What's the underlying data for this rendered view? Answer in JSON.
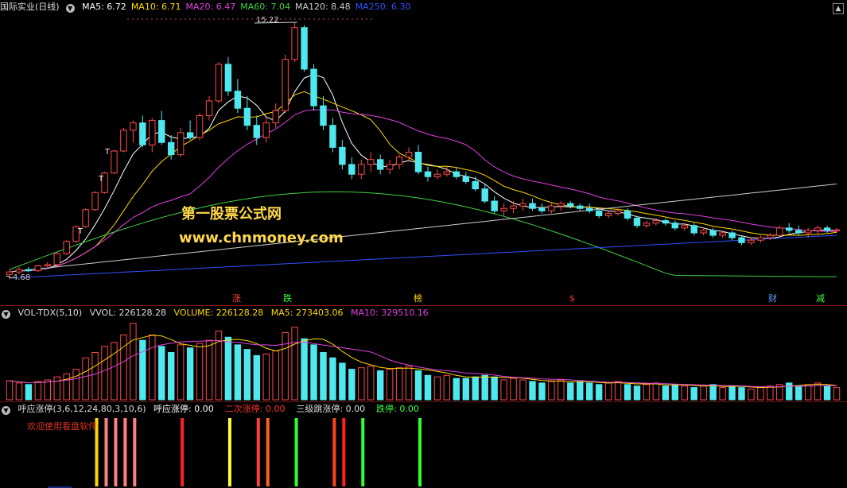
{
  "main": {
    "title": "国际实业(日线)",
    "ma": [
      {
        "label": "MA5: 6.72",
        "color": "#ffffff"
      },
      {
        "label": "MA10: 6.71",
        "color": "#ffd700"
      },
      {
        "label": "MA20: 6.47",
        "color": "#e040e0"
      },
      {
        "label": "MA60: 7.04",
        "color": "#40d040"
      },
      {
        "label": "MA120: 8.48",
        "color": "#cccccc"
      },
      {
        "label": "MA250: 6.30",
        "color": "#3050ff"
      }
    ],
    "high_label": "15.22",
    "low_label": "4.68",
    "t_marks": [
      "T",
      "T",
      "T"
    ],
    "watermark1": "第一股票公式网",
    "watermark2": "www.chnmoney.com",
    "events": [
      {
        "text": "涨",
        "color": "#ff4040"
      },
      {
        "text": "跌",
        "color": "#40ff40"
      },
      {
        "text": "榜",
        "color": "#ffd700"
      },
      {
        "text": "$",
        "color": "#ff3030"
      },
      {
        "text": "财",
        "color": "#60a0ff"
      },
      {
        "text": "减",
        "color": "#40ff40"
      }
    ]
  },
  "volume": {
    "name": "VOL-TDX(5,10)",
    "vvol": "VVOL: 226128.28",
    "volume": "VOLUME: 226128.28",
    "ma5": "MA5: 273403.06",
    "ma10": "MA10: 329510.16"
  },
  "indicator": {
    "name": "呼应涨停(3,6,12,24,80,3,10,6)",
    "items": [
      {
        "label": "呼应涨停: 0.00",
        "color": "#ffffff"
      },
      {
        "label": "二次涨停: 0.00",
        "color": "#ff3030"
      },
      {
        "label": "三级跳涨停: 0.00",
        "color": "#dddddd"
      },
      {
        "label": "跌停: 0.00",
        "color": "#40ff40"
      }
    ],
    "welcome": "欢迎使用看盘软件"
  },
  "chart_data": {
    "type": "candlestick",
    "price_range": [
      4.68,
      15.22
    ],
    "candles": [
      [
        4.9,
        5.1,
        4.7,
        5.0
      ],
      [
        5.0,
        5.2,
        4.9,
        5.1
      ],
      [
        5.1,
        5.2,
        5.0,
        5.05
      ],
      [
        5.05,
        5.3,
        5.0,
        5.25
      ],
      [
        5.25,
        5.4,
        5.2,
        5.3
      ],
      [
        5.3,
        5.8,
        5.3,
        5.75
      ],
      [
        5.75,
        6.3,
        5.7,
        6.25
      ],
      [
        6.25,
        6.9,
        6.2,
        6.85
      ],
      [
        6.85,
        7.6,
        6.8,
        7.55
      ],
      [
        7.55,
        8.3,
        7.5,
        8.25
      ],
      [
        8.25,
        9.1,
        8.2,
        9.05
      ],
      [
        9.05,
        10.0,
        9.0,
        9.95
      ],
      [
        9.95,
        10.9,
        9.9,
        10.8
      ],
      [
        10.8,
        11.2,
        10.3,
        11.1
      ],
      [
        11.1,
        11.4,
        10.1,
        10.2
      ],
      [
        10.2,
        11.3,
        9.9,
        11.2
      ],
      [
        11.2,
        11.6,
        10.2,
        10.3
      ],
      [
        10.3,
        10.6,
        9.6,
        9.8
      ],
      [
        9.8,
        10.9,
        9.7,
        10.7
      ],
      [
        10.7,
        11.2,
        10.4,
        10.5
      ],
      [
        10.5,
        11.5,
        10.4,
        11.4
      ],
      [
        11.4,
        12.2,
        11.2,
        12.0
      ],
      [
        12.0,
        13.6,
        11.9,
        13.5
      ],
      [
        13.5,
        13.8,
        12.2,
        12.4
      ],
      [
        12.4,
        12.9,
        11.5,
        11.7
      ],
      [
        11.7,
        12.2,
        10.8,
        11.0
      ],
      [
        11.0,
        11.4,
        10.2,
        10.5
      ],
      [
        10.5,
        11.3,
        10.3,
        11.1
      ],
      [
        11.1,
        11.9,
        10.9,
        11.6
      ],
      [
        11.6,
        13.9,
        11.5,
        13.7
      ],
      [
        13.7,
        15.22,
        13.6,
        15.0
      ],
      [
        15.0,
        15.1,
        13.2,
        13.3
      ],
      [
        13.3,
        13.5,
        11.6,
        11.8
      ],
      [
        11.8,
        12.2,
        10.8,
        11.0
      ],
      [
        11.0,
        11.3,
        9.9,
        10.1
      ],
      [
        10.1,
        10.4,
        9.2,
        9.4
      ],
      [
        9.4,
        9.7,
        8.8,
        9.0
      ],
      [
        9.0,
        9.6,
        8.8,
        9.4
      ],
      [
        9.4,
        9.9,
        9.1,
        9.6
      ],
      [
        9.6,
        9.8,
        9.0,
        9.2
      ],
      [
        9.2,
        9.6,
        9.0,
        9.4
      ],
      [
        9.4,
        9.8,
        9.2,
        9.7
      ],
      [
        9.7,
        10.1,
        9.5,
        9.9
      ],
      [
        9.9,
        10.2,
        9.0,
        9.1
      ],
      [
        9.1,
        9.3,
        8.7,
        8.9
      ],
      [
        8.9,
        9.2,
        8.8,
        9.0
      ],
      [
        9.0,
        9.3,
        8.9,
        9.1
      ],
      [
        9.1,
        9.3,
        8.8,
        8.9
      ],
      [
        8.9,
        9.1,
        8.6,
        8.7
      ],
      [
        8.7,
        8.9,
        8.3,
        8.4
      ],
      [
        8.4,
        8.6,
        7.8,
        7.9
      ],
      [
        7.9,
        8.1,
        7.4,
        7.5
      ],
      [
        7.5,
        7.8,
        7.3,
        7.6
      ],
      [
        7.6,
        7.9,
        7.4,
        7.7
      ],
      [
        7.7,
        8.0,
        7.5,
        7.8
      ],
      [
        7.8,
        8.0,
        7.5,
        7.6
      ],
      [
        7.6,
        7.8,
        7.4,
        7.5
      ],
      [
        7.5,
        7.8,
        7.4,
        7.7
      ],
      [
        7.7,
        7.9,
        7.5,
        7.8
      ],
      [
        7.8,
        7.9,
        7.6,
        7.7
      ],
      [
        7.7,
        7.8,
        7.5,
        7.6
      ],
      [
        7.6,
        7.8,
        7.4,
        7.5
      ],
      [
        7.5,
        7.6,
        7.2,
        7.3
      ],
      [
        7.3,
        7.5,
        7.2,
        7.4
      ],
      [
        7.4,
        7.6,
        7.3,
        7.5
      ],
      [
        7.5,
        7.6,
        7.1,
        7.2
      ],
      [
        7.2,
        7.3,
        6.8,
        6.9
      ],
      [
        6.9,
        7.1,
        6.8,
        7.0
      ],
      [
        7.0,
        7.2,
        6.9,
        7.1
      ],
      [
        7.1,
        7.2,
        6.9,
        7.0
      ],
      [
        7.0,
        7.1,
        6.7,
        6.8
      ],
      [
        6.8,
        7.0,
        6.7,
        6.9
      ],
      [
        6.9,
        7.0,
        6.5,
        6.6
      ],
      [
        6.6,
        6.8,
        6.5,
        6.7
      ],
      [
        6.7,
        6.8,
        6.4,
        6.5
      ],
      [
        6.5,
        6.7,
        6.4,
        6.6
      ],
      [
        6.6,
        6.7,
        6.3,
        6.4
      ],
      [
        6.4,
        6.5,
        6.1,
        6.2
      ],
      [
        6.2,
        6.4,
        6.1,
        6.3
      ],
      [
        6.3,
        6.5,
        6.2,
        6.4
      ],
      [
        6.4,
        6.6,
        6.3,
        6.5
      ],
      [
        6.5,
        6.9,
        6.4,
        6.8
      ],
      [
        6.8,
        7.0,
        6.6,
        6.7
      ],
      [
        6.7,
        6.9,
        6.5,
        6.6
      ],
      [
        6.6,
        6.8,
        6.4,
        6.7
      ],
      [
        6.7,
        6.9,
        6.5,
        6.8
      ],
      [
        6.8,
        6.9,
        6.6,
        6.7
      ],
      [
        6.7,
        6.8,
        6.6,
        6.72
      ]
    ],
    "ma_lines": [
      {
        "name": "MA5",
        "color": "#ffffff",
        "period": 5
      },
      {
        "name": "MA10",
        "color": "#ffd700",
        "period": 10
      },
      {
        "name": "MA20",
        "color": "#e040e0",
        "period": 20
      },
      {
        "name": "MA60",
        "color": "#40d040",
        "period": 60
      },
      {
        "name": "MA120",
        "color": "#cccccc",
        "period": 120
      },
      {
        "name": "MA250",
        "color": "#3050ff",
        "period": 250
      }
    ],
    "volume": [
      25,
      22,
      20,
      24,
      26,
      30,
      34,
      40,
      55,
      62,
      70,
      75,
      85,
      100,
      78,
      85,
      70,
      62,
      72,
      68,
      74,
      78,
      90,
      82,
      72,
      66,
      58,
      60,
      64,
      88,
      95,
      80,
      72,
      62,
      55,
      48,
      40,
      42,
      44,
      38,
      40,
      42,
      44,
      38,
      32,
      30,
      32,
      28,
      28,
      30,
      32,
      30,
      26,
      28,
      26,
      24,
      22,
      24,
      26,
      22,
      24,
      22,
      20,
      22,
      24,
      20,
      18,
      20,
      22,
      18,
      20,
      18,
      16,
      18,
      20,
      16,
      18,
      16,
      14,
      16,
      18,
      20,
      22,
      18,
      20,
      22,
      18,
      16
    ],
    "volume_max": 100,
    "signals": [
      {
        "index": 10,
        "color": "#ffd700"
      },
      {
        "index": 11,
        "color": "#ff8080"
      },
      {
        "index": 12,
        "color": "#ff8080"
      },
      {
        "index": 13,
        "color": "#ff8080"
      },
      {
        "index": 14,
        "color": "#ff8080"
      },
      {
        "index": 19,
        "color": "#ff2020"
      },
      {
        "index": 24,
        "color": "#ffff40"
      },
      {
        "index": 27,
        "color": "#ff4040"
      },
      {
        "index": 28,
        "color": "#ff6020"
      },
      {
        "index": 31,
        "color": "#30ff30"
      },
      {
        "index": 35,
        "color": "#ff4020"
      },
      {
        "index": 36,
        "color": "#ff2020"
      },
      {
        "index": 38,
        "color": "#30ff30"
      },
      {
        "index": 44,
        "color": "#30ff30"
      }
    ]
  }
}
